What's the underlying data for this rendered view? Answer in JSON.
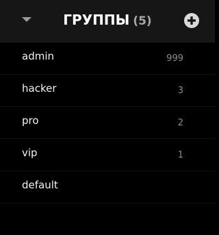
{
  "header": {
    "title": "ГРУППЫ",
    "count": "(5)",
    "collapse_icon": "caret-down-icon",
    "add_icon": "plus-circle-icon"
  },
  "groups": [
    {
      "name": "admin",
      "count": "999"
    },
    {
      "name": "hacker",
      "count": "3"
    },
    {
      "name": "pro",
      "count": "2"
    },
    {
      "name": "vip",
      "count": "1"
    },
    {
      "name": "default",
      "count": ""
    }
  ],
  "colors": {
    "background": "#000000",
    "header_background": "#161616",
    "text": "#ffffff",
    "muted_text": "#a8a8a8"
  }
}
